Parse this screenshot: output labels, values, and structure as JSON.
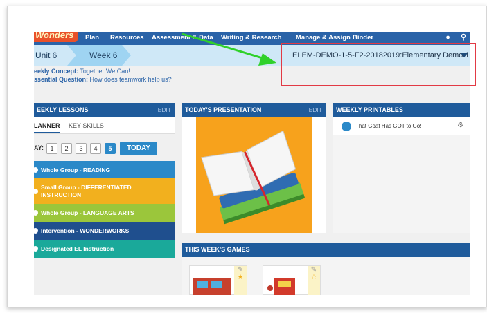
{
  "nav": {
    "logo": "Wonders",
    "items": [
      "Plan",
      "Resources",
      "Assessment & Data",
      "Writing & Research",
      "Manage & Assign",
      "Binder"
    ]
  },
  "unitbar": {
    "unit": "Unit 6",
    "week": "Week 6",
    "class_select": "ELEM-DEMO-1-5-F2-20182019:Elementary Demo 1"
  },
  "concept": {
    "concept_label": "eekly Concept:",
    "concept_value": "Together We Can!",
    "question_label": "ssential Question:",
    "question_value": "How does teamwork help us?"
  },
  "lessons": {
    "title": "EEKLY LESSONS",
    "edit": "EDIT",
    "tabs": [
      "LANNER",
      "KEY SKILLS"
    ],
    "day_label": "AY:",
    "days": [
      "1",
      "2",
      "3",
      "4",
      "5"
    ],
    "active_day": "5",
    "today": "TODAY",
    "items": [
      {
        "label": "Whole Group - READING",
        "color": "#2b89c8"
      },
      {
        "label": "Small Group - DIFFERENTIATED INSTRUCTION",
        "color": "#f2b01e"
      },
      {
        "label": "Whole Group - LANGUAGE ARTS",
        "color": "#9bc63b"
      },
      {
        "label": "Intervention - WONDERWORKS",
        "color": "#1f4f8e"
      },
      {
        "label": "Designated EL Instruction",
        "color": "#1aa99a"
      }
    ]
  },
  "presentation": {
    "title": "TODAY'S PRESENTATION",
    "edit": "EDIT"
  },
  "printables": {
    "title": "WEEKLY PRINTABLES",
    "item": "That Goat Has GOT to Go!"
  },
  "games": {
    "title": "THIS WEEK'S GAMES"
  },
  "colors": {
    "nav": "#2a63a8",
    "panel_header": "#1f5b9b",
    "highlight_box": "#e23a45",
    "arrow": "#2fd12a"
  }
}
